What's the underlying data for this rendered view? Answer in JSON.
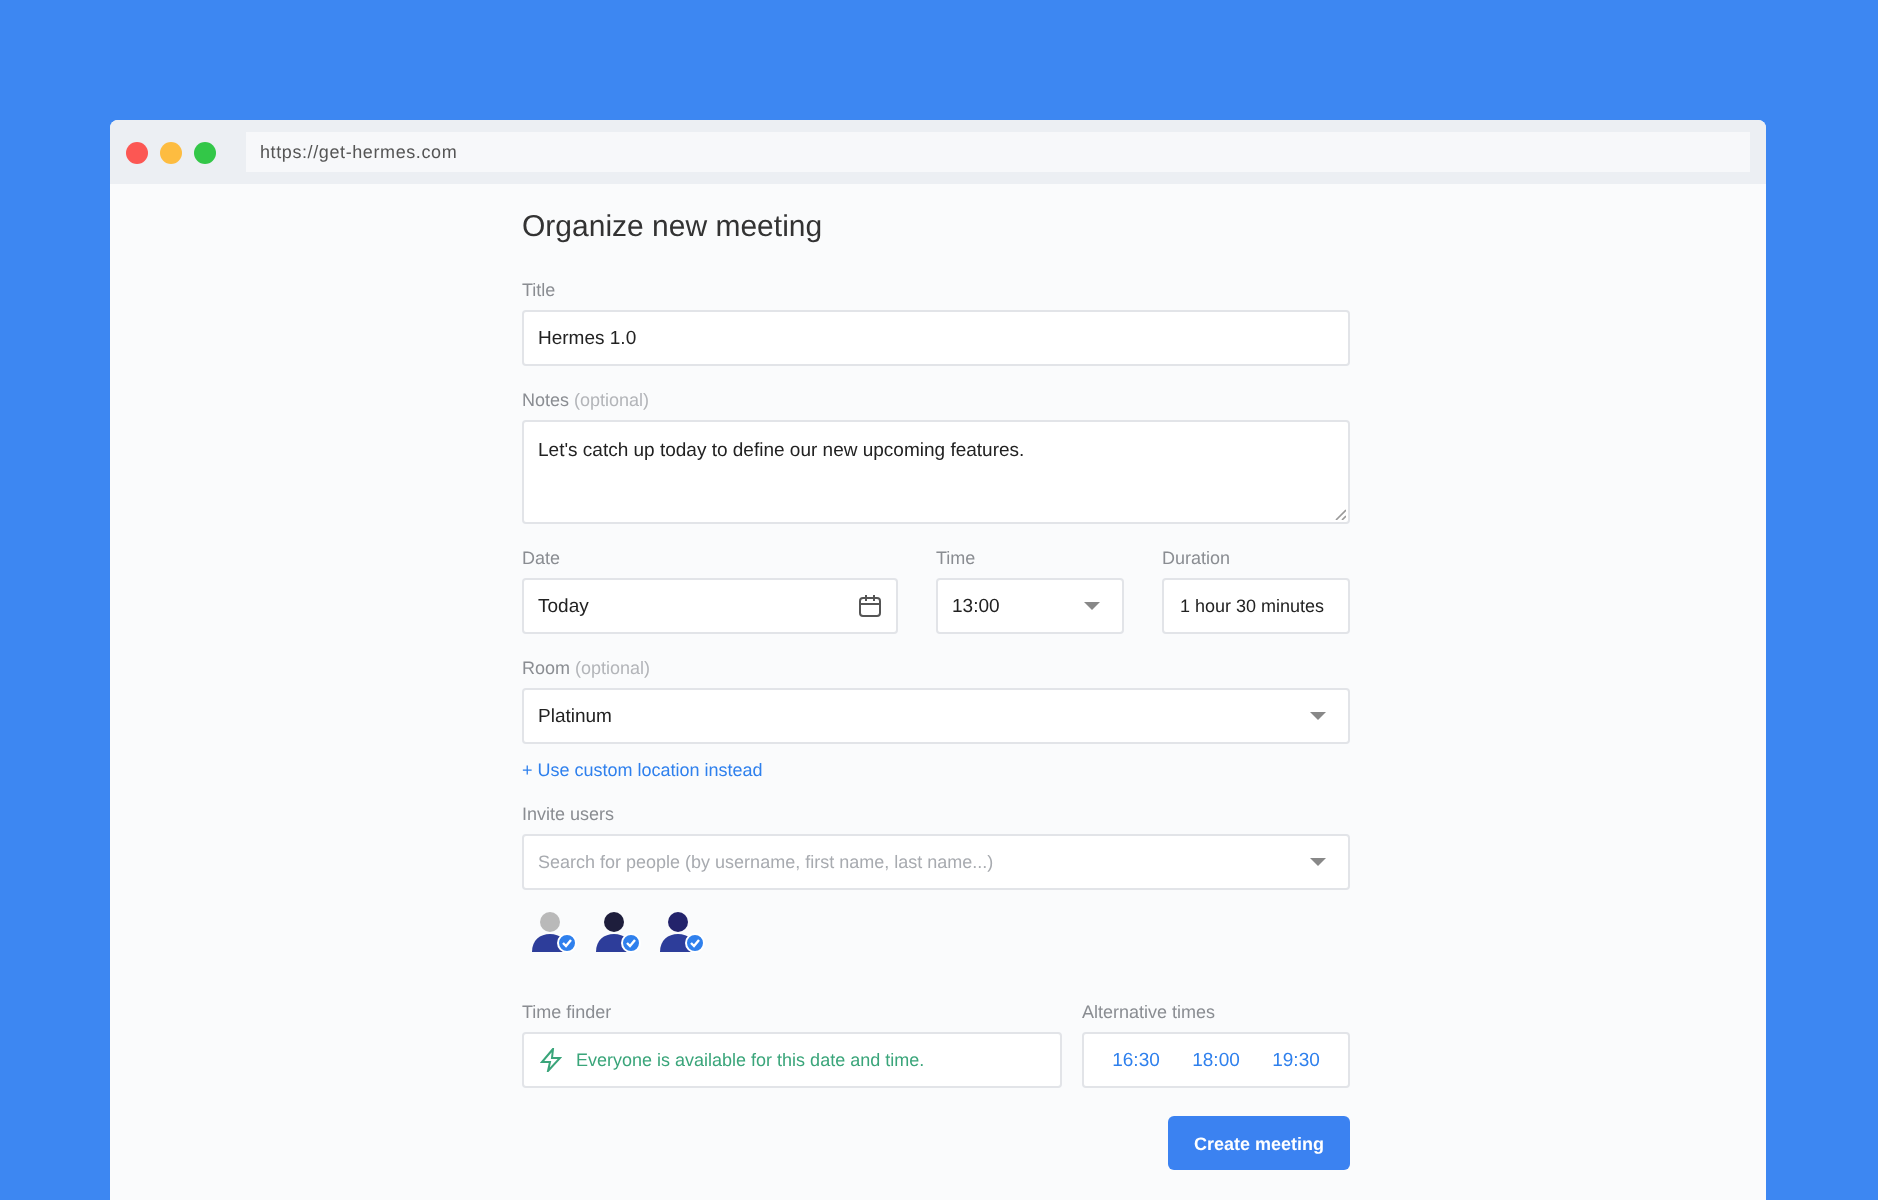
{
  "browser": {
    "url": "https://get-hermes.com"
  },
  "form": {
    "heading": "Organize new meeting",
    "title": {
      "label": "Title",
      "value": "Hermes 1.0"
    },
    "notes": {
      "label": "Notes",
      "hint": "(optional)",
      "value": "Let's catch up today to define our new upcoming features."
    },
    "date": {
      "label": "Date",
      "value": "Today"
    },
    "time": {
      "label": "Time",
      "value": "13:00"
    },
    "duration": {
      "label": "Duration",
      "value": "1 hour 30 minutes"
    },
    "room": {
      "label": "Room",
      "hint": "(optional)",
      "value": "Platinum"
    },
    "custom_location_link": "+ Use custom location instead",
    "invite": {
      "label": "Invite users",
      "placeholder": "Search for people (by username, first name, last name...)"
    },
    "invitees": [
      {
        "color": "#b9b9b9"
      },
      {
        "color": "#1e1e3c"
      },
      {
        "color": "#23236b"
      }
    ],
    "time_finder": {
      "label": "Time finder",
      "message": "Everyone is available for this date and time."
    },
    "alternative_times": {
      "label": "Alternative times",
      "times": [
        "16:30",
        "18:00",
        "19:30"
      ]
    },
    "submit": "Create meeting"
  }
}
